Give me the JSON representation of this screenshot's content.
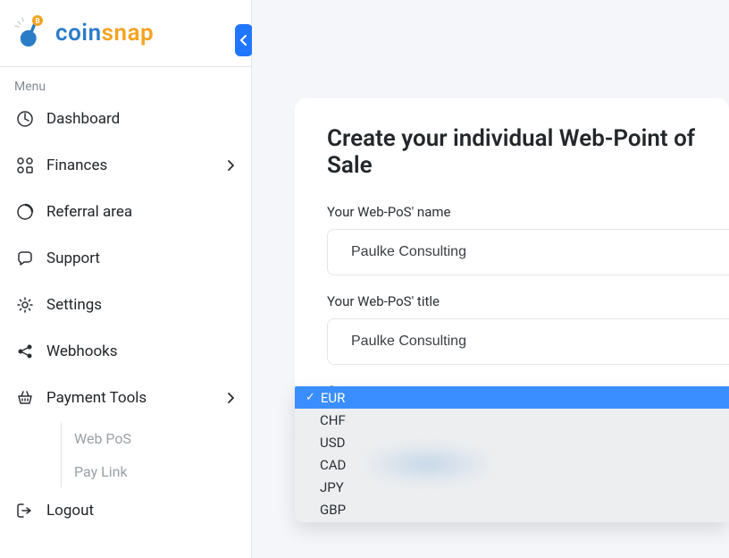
{
  "brand": {
    "coin": "coin",
    "snap": "snap"
  },
  "sidebar": {
    "menu_label": "Menu",
    "items": {
      "dashboard": "Dashboard",
      "finances": "Finances",
      "referral": "Referral area",
      "support": "Support",
      "settings": "Settings",
      "webhooks": "Webhooks",
      "payment_tools": "Payment Tools",
      "logout": "Logout"
    },
    "subitems": {
      "web_pos": "Web PoS",
      "pay_link": "Pay Link"
    }
  },
  "page": {
    "heading": "Create your individual Web-Point of Sale",
    "name_label": "Your Web-PoS' name",
    "name_value": "Paulke Consulting",
    "title_label": "Your Web-PoS' title",
    "title_value": "Paulke Consulting",
    "currency_label": "Currency"
  },
  "currency": {
    "selected": "EUR",
    "options": [
      "EUR",
      "CHF",
      "USD",
      "CAD",
      "JPY",
      "GBP"
    ]
  }
}
